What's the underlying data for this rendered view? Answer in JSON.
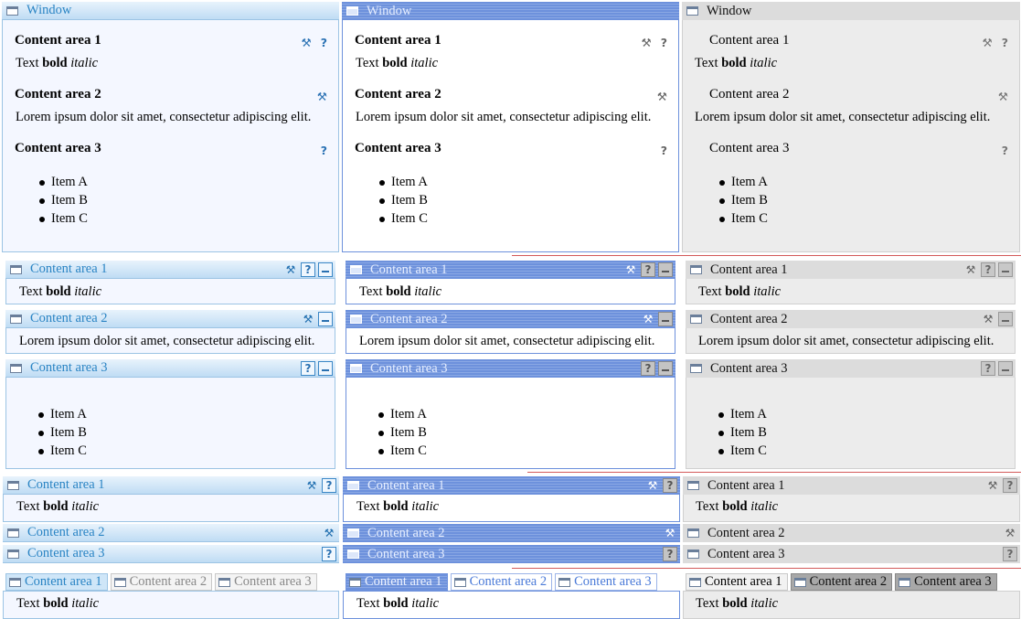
{
  "window_title": "Window",
  "sections": [
    {
      "title": "Content area 1",
      "text_plain": "Text ",
      "text_bold": "bold",
      "text_italic": "italic"
    },
    {
      "title": "Content area 2",
      "lorem": "Lorem ipsum dolor sit amet, consectetur adipiscing elit."
    },
    {
      "title": "Content area 3",
      "items": [
        "Item A",
        "Item B",
        "Item C"
      ]
    }
  ],
  "icons": {
    "wrench": "wrench-icon",
    "help": "help-icon",
    "minimize": "minimize-icon",
    "window": "window-icon"
  },
  "glyphs": {
    "wrench": "⚒",
    "help": "?"
  },
  "tabs": [
    "Content area 1",
    "Content area 2",
    "Content area 3"
  ],
  "themes": {
    "a": {
      "name": "blue-light",
      "accent": "#2a84c4",
      "body_bg": "#f4f7ff"
    },
    "b": {
      "name": "blue-striped",
      "accent": "#6d91dc",
      "body_bg": "#ffffff"
    },
    "c": {
      "name": "gray",
      "accent": "#dcdcdc",
      "body_bg": "#ececec"
    }
  }
}
